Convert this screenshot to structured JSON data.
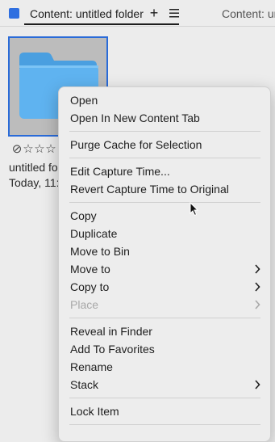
{
  "tabbar": {
    "active_tab_title": "Content: untitled folder",
    "add_tab_label": "+",
    "second_tab_title": "Content: ur"
  },
  "thumbnail": {
    "name": "untitled fo",
    "date": "Today, 11:"
  },
  "context_menu": {
    "open": "Open",
    "open_new_tab": "Open In New Content Tab",
    "purge_cache": "Purge Cache for Selection",
    "edit_capture_time": "Edit Capture Time...",
    "revert_capture_time": "Revert Capture Time to Original",
    "copy": "Copy",
    "duplicate": "Duplicate",
    "move_to_bin": "Move to Bin",
    "move_to": "Move to",
    "copy_to": "Copy to",
    "place": "Place",
    "reveal_in_finder": "Reveal in Finder",
    "add_to_favorites": "Add To Favorites",
    "rename": "Rename",
    "stack": "Stack",
    "lock_item": "Lock Item"
  },
  "colors": {
    "accent": "#2f6fe0",
    "folder": "#5fb3f0",
    "menu_bg": "#ededed"
  }
}
